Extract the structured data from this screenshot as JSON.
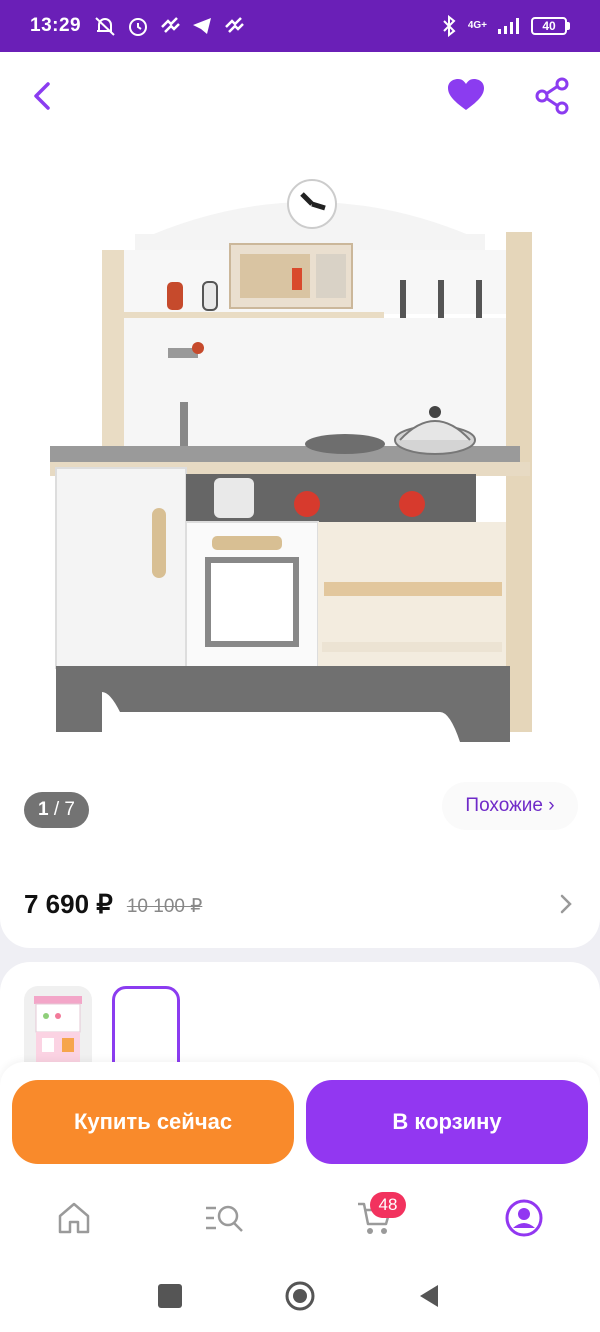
{
  "status_bar": {
    "time": "13:29",
    "network": "4G+",
    "battery": "40"
  },
  "top_bar": {
    "back_icon": "chevron-left-icon",
    "favorite_icon": "heart-icon",
    "share_icon": "share-icon"
  },
  "gallery": {
    "current": "1",
    "total": "/ 7",
    "similar_label": "Похожие ›"
  },
  "price": {
    "current": "7 690 ₽",
    "old": "10 100 ₽"
  },
  "actions": {
    "buy_now": "Купить сейчас",
    "add_to_cart": "В корзину"
  },
  "bottom_nav": {
    "items": [
      "home-icon",
      "catalog-search-icon",
      "cart-icon",
      "profile-icon"
    ],
    "cart_badge": "48"
  },
  "colors": {
    "accent": "#9237f1",
    "status_bar": "#6a1fb7",
    "buy_button": "#f98a2b",
    "badge": "#f2325e"
  }
}
